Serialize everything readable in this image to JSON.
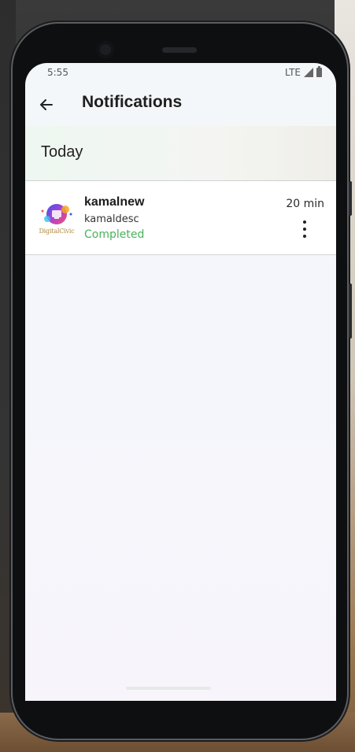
{
  "status_bar": {
    "time": "5:55",
    "network": "LTE"
  },
  "app_bar": {
    "title": "Notifications"
  },
  "sections": [
    {
      "title": "Today",
      "items": [
        {
          "logo_text": "DigitalCivic",
          "title": "kamalnew",
          "description": "kamaldesc",
          "status": "Completed",
          "time": "20 min"
        }
      ]
    }
  ],
  "colors": {
    "status_completed": "#49b25a",
    "text_primary": "#1f1f1f"
  },
  "icons": {
    "back": "arrow-left-icon",
    "more": "more-vertical-icon",
    "signal": "signal-icon",
    "battery": "battery-icon"
  }
}
